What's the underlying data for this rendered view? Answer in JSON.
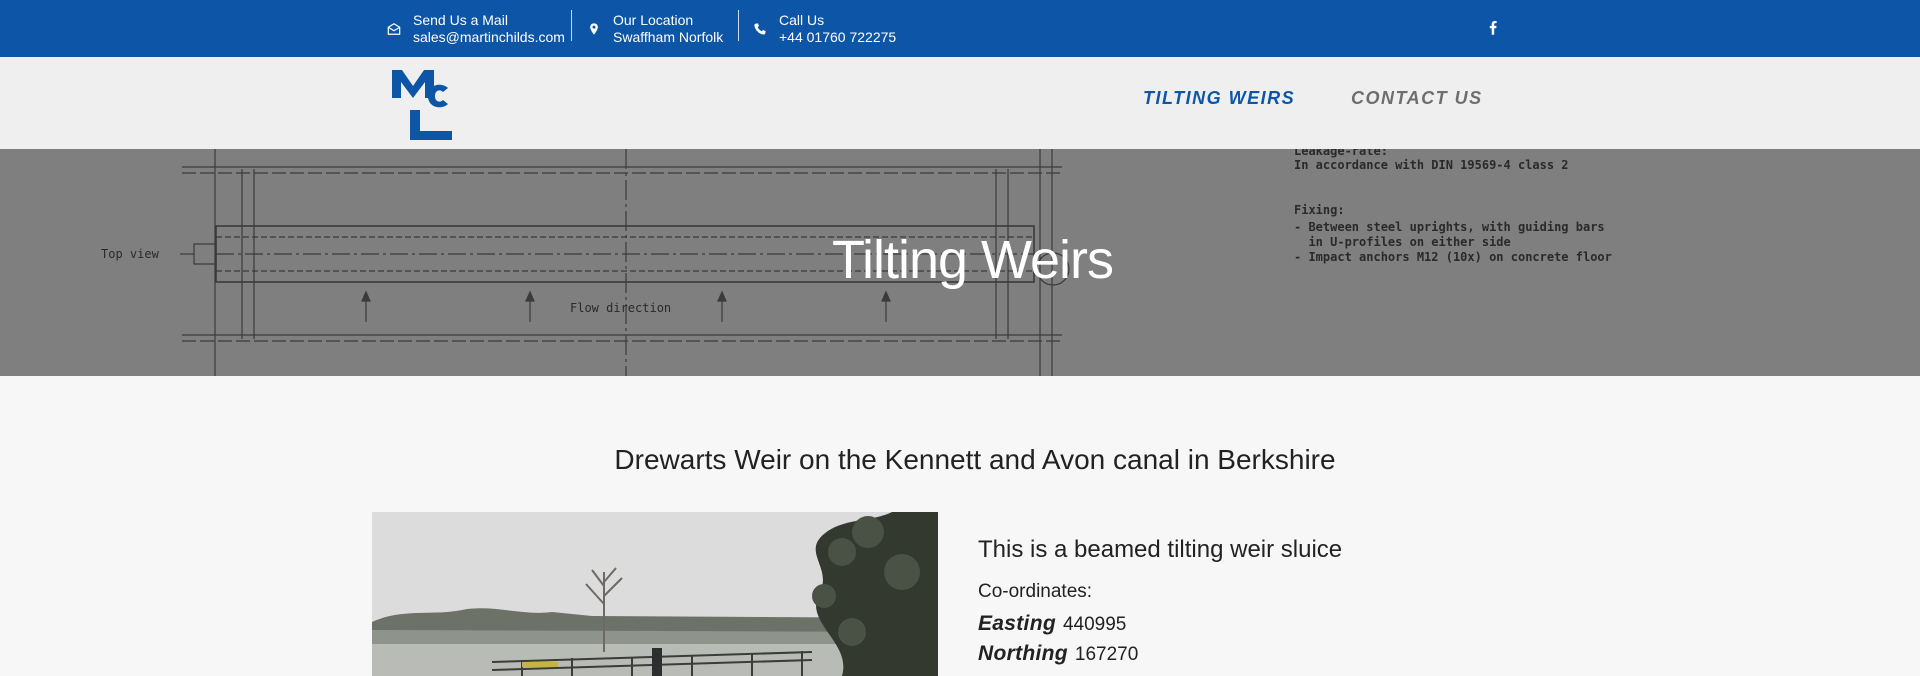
{
  "topbar": {
    "mail": {
      "label": "Send Us a Mail",
      "value": "sales@martinchilds.com"
    },
    "location": {
      "label": "Our Location",
      "value": "Swaffham Norfolk"
    },
    "phone": {
      "label": "Call Us",
      "value": "+44 01760 722275"
    },
    "social": {
      "icon": "facebook-icon"
    }
  },
  "nav": {
    "logo_alt": "MCL",
    "items": [
      {
        "label": "TILTING WEIRS",
        "active": true
      },
      {
        "label": "CONTACT US",
        "active": false
      }
    ]
  },
  "hero": {
    "title": "Tilting Weirs",
    "drawing": {
      "top_view": "Top view",
      "flow_direction": "Flow direction",
      "leakage": "Leakage-rate:",
      "leakage_text": "In accordance with DIN 19569-4 class 2",
      "fixing": "Fixing:",
      "fixing_1": "- Between steel uprights, with guiding bars",
      "fixing_2": "  in U-profiles on either side",
      "fixing_3": "- Impact anchors M12 (10x) on concrete floor"
    }
  },
  "content": {
    "heading": "Drewarts Weir on the Kennett and Avon canal in Berkshire",
    "subheading": "This is a beamed tilting weir sluice",
    "coordinates_label": "Co-ordinates:",
    "easting": {
      "label": "Easting",
      "value": "440995"
    },
    "northing": {
      "label": "Northing",
      "value": "167270"
    }
  },
  "colors": {
    "brand_blue": "#0d55a6",
    "nav_grey": "#6e6e6e"
  }
}
